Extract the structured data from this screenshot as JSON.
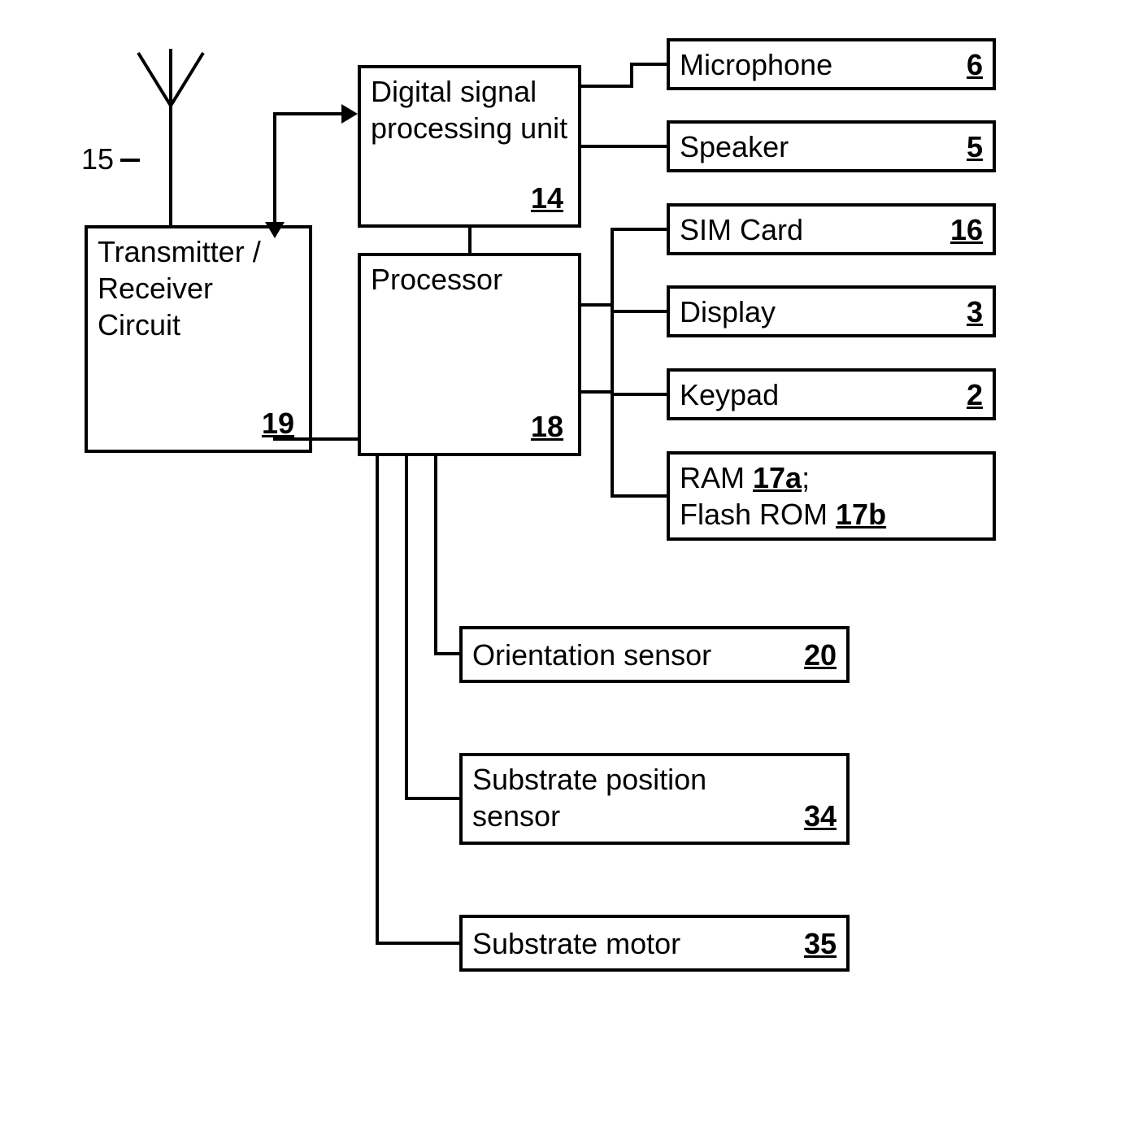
{
  "blocks": {
    "txrx": {
      "label": "Transmitter / Receiver Circuit",
      "ref": "19"
    },
    "dsp": {
      "label": "Digital signal processing unit",
      "ref": "14"
    },
    "proc": {
      "label": "Processor",
      "ref": "18"
    },
    "mic": {
      "label": "Microphone",
      "ref": "6"
    },
    "speaker": {
      "label": "Speaker",
      "ref": "5"
    },
    "sim": {
      "label": "SIM Card",
      "ref": "16"
    },
    "display": {
      "label": "Display",
      "ref": "3"
    },
    "keypad": {
      "label": "Keypad",
      "ref": "2"
    },
    "memory": {
      "line1_prefix": "RAM ",
      "line1_ref": "17a",
      "line1_suffix": ";",
      "line2_prefix": "Flash ROM ",
      "line2_ref": "17b"
    },
    "orientation": {
      "label": "Orientation sensor",
      "ref": "20"
    },
    "substrate_pos": {
      "line1": "Substrate position",
      "line2": "sensor",
      "ref": "34"
    },
    "substrate_motor": {
      "label": "Substrate motor",
      "ref": "35"
    }
  },
  "antenna_ref": "15"
}
